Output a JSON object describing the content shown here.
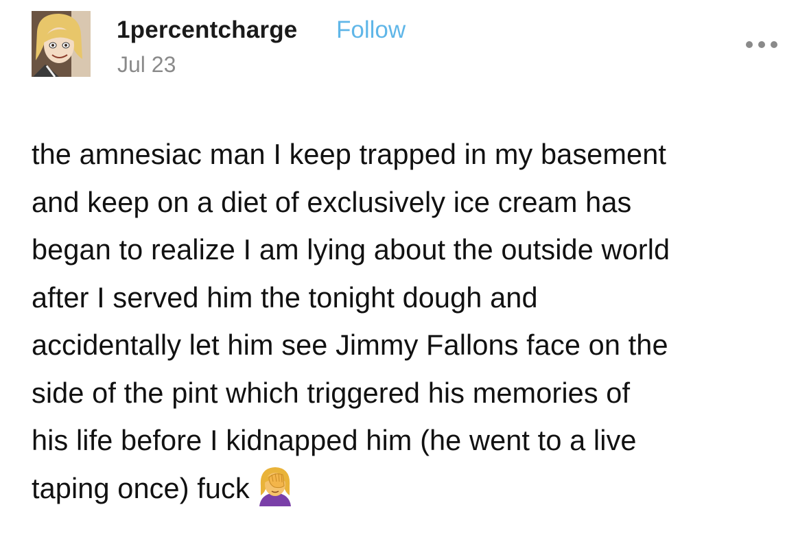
{
  "post": {
    "username": "1percentcharge",
    "follow_label": "Follow",
    "date": "Jul 23",
    "more_icon": "more-options-icon",
    "avatar_icon": "avatar-cartoon-blonde",
    "body_lines": [
      "the amnesiac man I keep trapped in my basement",
      "and keep on a diet of exclusively ice cream has",
      "began to realize I am lying about the outside world",
      "after I served him the tonight dough and",
      "accidentally let him see Jimmy Fallons face on the",
      "side of the pint which triggered his memories of",
      "his life before I kidnapped him (he went to a live",
      "taping once)  fuck"
    ],
    "emoji": "face-palm-woman-icon"
  },
  "colors": {
    "follow": "#5fb6e8",
    "date": "#8a8a8a",
    "text": "#111111",
    "more_dots": "#8a8a8a"
  }
}
